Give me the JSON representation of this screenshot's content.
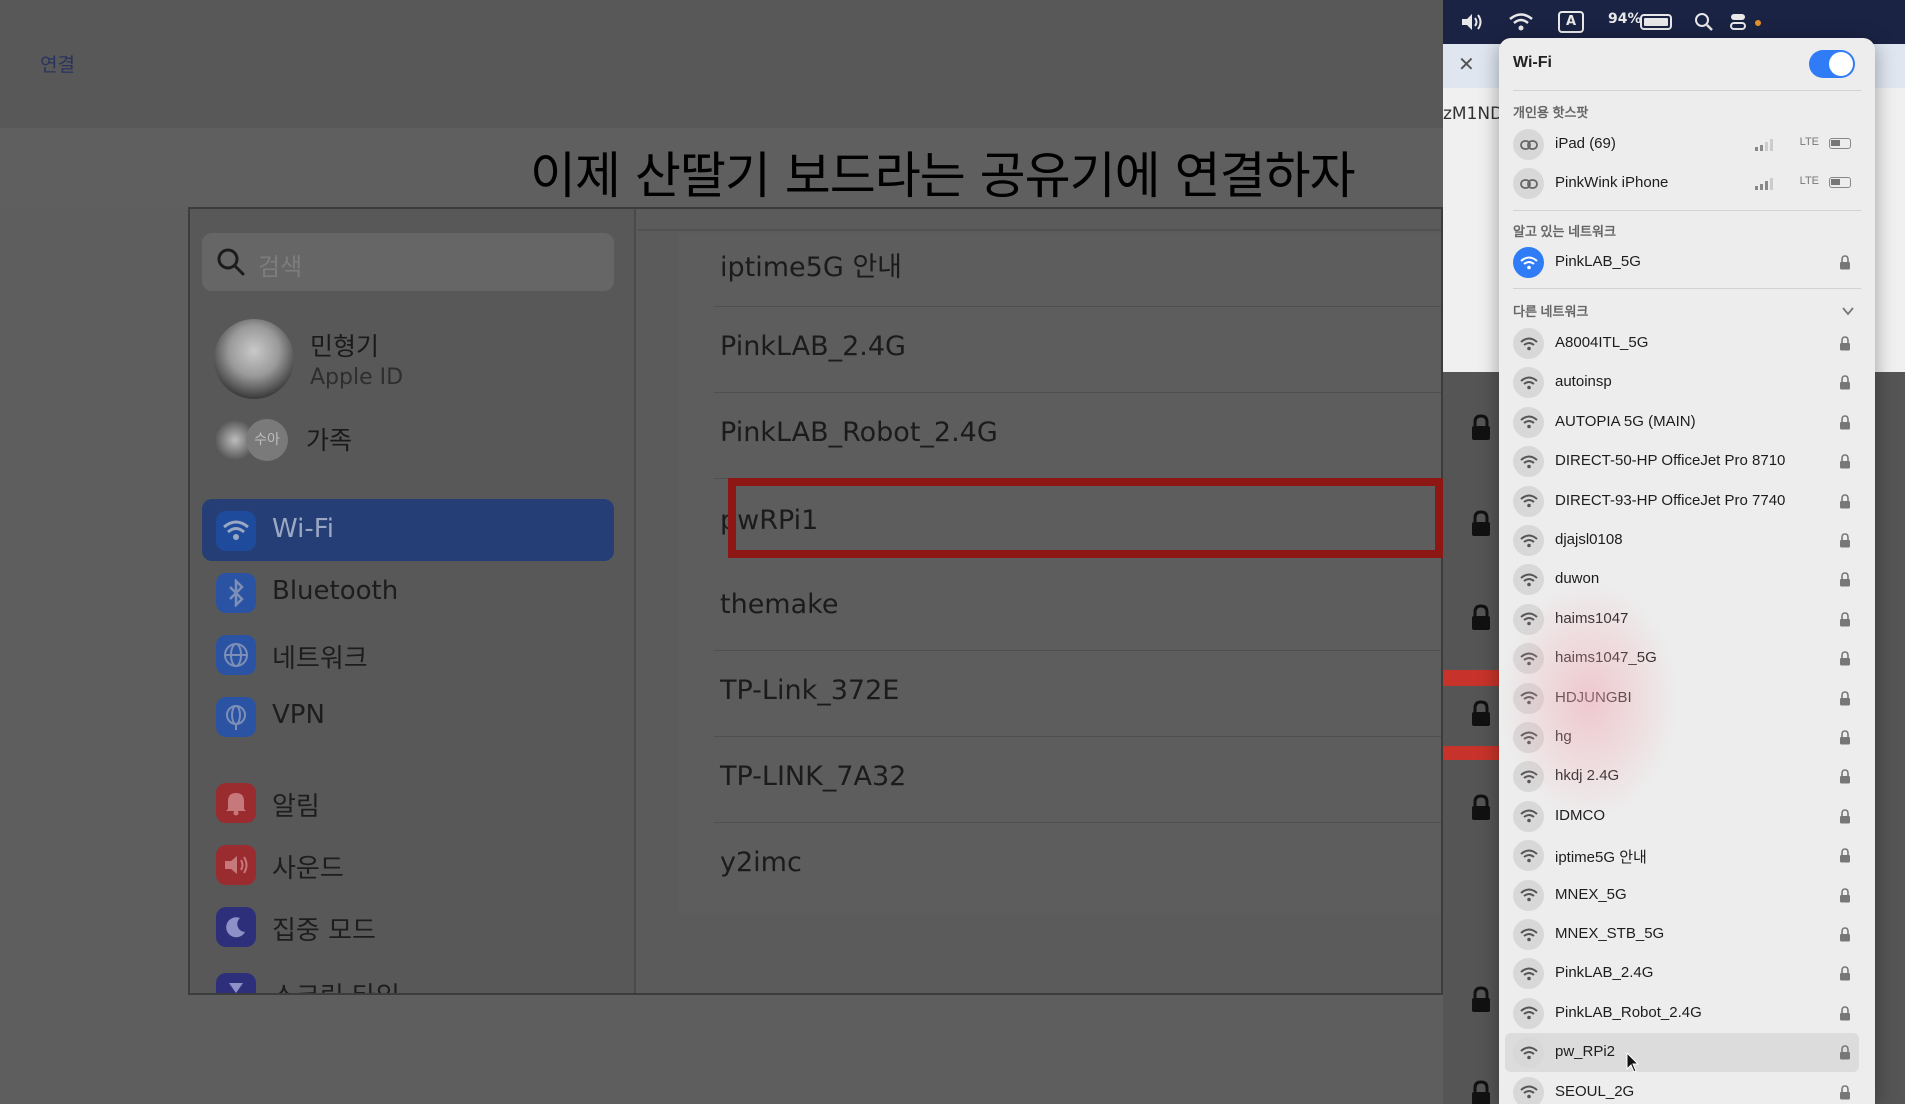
{
  "background": {
    "top_link": "연결",
    "slide_title": "이제 산딸기 보드라는 공유기에 연결하자",
    "right_pane_code": "zM1ND"
  },
  "settings": {
    "search_placeholder": "검색",
    "profile": {
      "name": "민형기",
      "subtitle": "Apple ID"
    },
    "family": {
      "avatar_text": "수아",
      "label": "가족"
    },
    "sidebar_items": [
      {
        "label": "Wi-Fi",
        "icon": "wifi-icon",
        "active": true
      },
      {
        "label": "Bluetooth",
        "icon": "bluetooth-icon"
      },
      {
        "label": "네트워크",
        "icon": "globe-icon"
      },
      {
        "label": "VPN",
        "icon": "vpn-globe-icon"
      },
      {
        "label": "알림",
        "icon": "bell-icon"
      },
      {
        "label": "사운드",
        "icon": "speaker-icon"
      },
      {
        "label": "집중 모드",
        "icon": "moon-icon"
      },
      {
        "label": "스크린 타임",
        "icon": "hourglass-icon"
      }
    ],
    "networks": [
      "iptime5G  안내",
      "PinkLAB_2.4G",
      "PinkLAB_Robot_2.4G",
      "pwRPi1",
      "themake",
      "TP-Link_372E",
      "TP-LINK_7A32",
      "y2imc"
    ],
    "highlighted_network": "pwRPi1"
  },
  "menubar": {
    "battery_percent": "94%",
    "input_source": "A"
  },
  "wifi_menu": {
    "title": "Wi-Fi",
    "enabled": true,
    "hotspot_section": "개인용 핫스팟",
    "hotspots": [
      {
        "name": "iPad (69)",
        "signal": "LTE"
      },
      {
        "name": "PinkWink iPhone",
        "signal": "LTE"
      }
    ],
    "known_section": "알고 있는 네트워크",
    "known": [
      {
        "name": "PinkLAB_5G"
      }
    ],
    "other_section": "다른 네트워크",
    "others": [
      "A8004ITL_5G",
      "autoinsp",
      "AUTOPIA 5G  (MAIN)",
      "DIRECT-50-HP OfficeJet Pro 8710",
      "DIRECT-93-HP OfficeJet Pro 7740",
      "djajsl0108",
      "duwon",
      "haims1047",
      "haims1047_5G",
      "HDJUNGBI",
      "hg",
      "hkdj 2.4G",
      "IDMCO",
      "iptime5G  안내",
      "MNEX_5G",
      "MNEX_STB_5G",
      "PinkLAB_2.4G",
      "PinkLAB_Robot_2.4G",
      "pw_RPi2",
      "SEOUL_2G"
    ],
    "hovered": "pw_RPi2",
    "accent_color": "#2f7cf6"
  }
}
